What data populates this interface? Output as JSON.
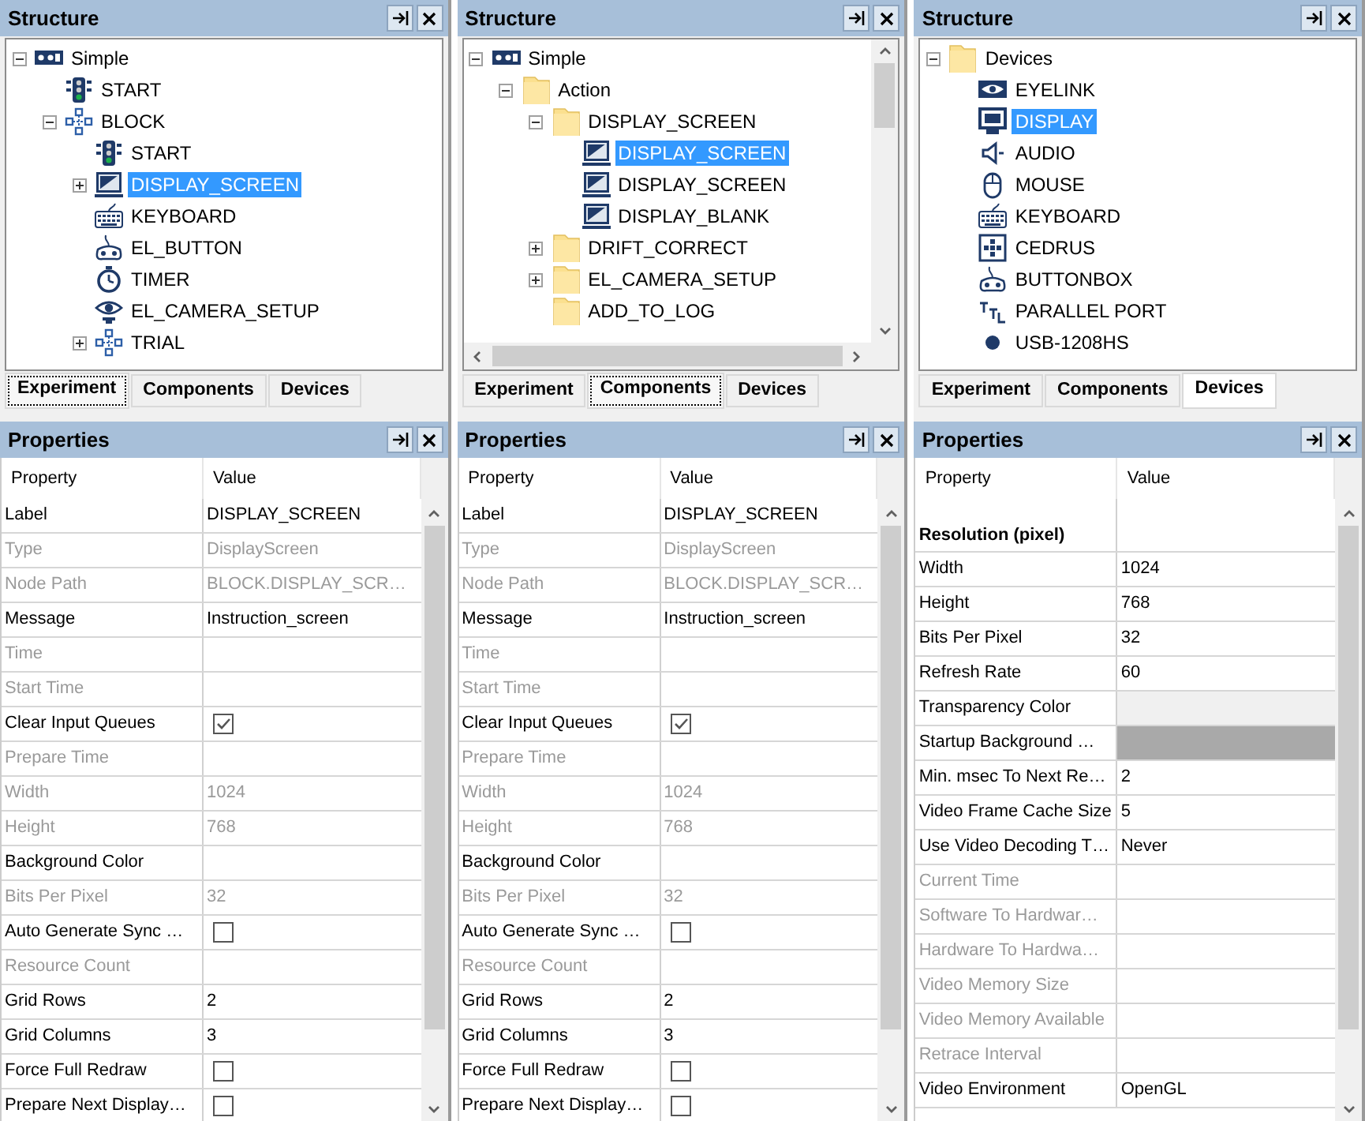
{
  "panels": [
    {
      "structure": {
        "kind": "plain",
        "title": "Structure",
        "tree": [
          {
            "label": "Simple",
            "kind": "experiment",
            "expanded": true,
            "selected": false,
            "children": [
              {
                "label": "START",
                "kind": "start",
                "selected": false
              },
              {
                "label": "BLOCK",
                "kind": "block",
                "expanded": true,
                "selected": false,
                "children": [
                  {
                    "label": "START",
                    "kind": "start",
                    "selected": false
                  },
                  {
                    "label": "DISPLAY_SCREEN",
                    "kind": "display",
                    "expanded": false,
                    "selected": true
                  },
                  {
                    "label": "KEYBOARD",
                    "kind": "keyboard",
                    "selected": false
                  },
                  {
                    "label": "EL_BUTTON",
                    "kind": "gamepad",
                    "selected": false
                  },
                  {
                    "label": "TIMER",
                    "kind": "timer",
                    "selected": false
                  },
                  {
                    "label": "EL_CAMERA_SETUP",
                    "kind": "camera",
                    "selected": false
                  },
                  {
                    "label": "TRIAL",
                    "kind": "block",
                    "expanded": false,
                    "selected": false
                  }
                ]
              }
            ]
          }
        ],
        "tabs": [
          {
            "label": "Experiment",
            "selected": true
          },
          {
            "label": "Components",
            "selected": false
          },
          {
            "label": "Devices",
            "selected": false
          }
        ]
      },
      "properties": {
        "title": "Properties",
        "columns": [
          "Property",
          "Value"
        ],
        "rows": [
          {
            "kind": "text",
            "property": "Label",
            "value": "DISPLAY_SCREEN",
            "disabled": false
          },
          {
            "kind": "text",
            "property": "Type",
            "value": "DisplayScreen",
            "disabled": true
          },
          {
            "kind": "text",
            "property": "Node Path",
            "value": "BLOCK.DISPLAY_SCR…",
            "disabled": true
          },
          {
            "kind": "text",
            "property": "Message",
            "value": "Instruction_screen",
            "disabled": false
          },
          {
            "kind": "text",
            "property": "Time",
            "disabled": true
          },
          {
            "kind": "text",
            "property": "Start Time",
            "disabled": true
          },
          {
            "kind": "checkbox",
            "property": "Clear Input Queues",
            "checked": true,
            "disabled": false
          },
          {
            "kind": "text",
            "property": "Prepare Time",
            "disabled": true
          },
          {
            "kind": "text",
            "property": "Width",
            "value": "1024",
            "disabled": true
          },
          {
            "kind": "text",
            "property": "Height",
            "value": "768",
            "disabled": true
          },
          {
            "kind": "text",
            "property": "Background Color",
            "disabled": false
          },
          {
            "kind": "text",
            "property": "Bits Per Pixel",
            "value": "32",
            "disabled": true
          },
          {
            "kind": "checkbox",
            "property": "Auto Generate Sync …",
            "checked": false,
            "disabled": false
          },
          {
            "kind": "text",
            "property": "Resource Count",
            "disabled": true
          },
          {
            "kind": "text",
            "property": "Grid Rows",
            "value": "2",
            "disabled": false
          },
          {
            "kind": "text",
            "property": "Grid Columns",
            "value": "3",
            "disabled": false
          },
          {
            "kind": "checkbox",
            "property": "Force Full Redraw",
            "checked": false,
            "disabled": false
          },
          {
            "kind": "checkbox",
            "property": "Prepare Next Display…",
            "checked": false,
            "disabled": false
          }
        ]
      }
    },
    {
      "structure": {
        "kind": "scrolled",
        "title": "Structure",
        "tree": [
          {
            "label": "Simple",
            "kind": "experiment",
            "expanded": true,
            "selected": false,
            "children": [
              {
                "label": "Action",
                "kind": "folder",
                "expanded": true,
                "selected": false,
                "children": [
                  {
                    "label": "DISPLAY_SCREEN",
                    "kind": "folder",
                    "expanded": true,
                    "selected": false,
                    "children": [
                      {
                        "label": "DISPLAY_SCREEN",
                        "kind": "display",
                        "selected": true
                      },
                      {
                        "label": "DISPLAY_SCREEN",
                        "kind": "display",
                        "selected": false
                      },
                      {
                        "label": "DISPLAY_BLANK",
                        "kind": "display",
                        "selected": false
                      }
                    ]
                  },
                  {
                    "label": "DRIFT_CORRECT",
                    "kind": "folder",
                    "expanded": false,
                    "selected": false
                  },
                  {
                    "label": "EL_CAMERA_SETUP",
                    "kind": "folder",
                    "expanded": false,
                    "selected": false
                  },
                  {
                    "label": "ADD_TO_LOG",
                    "kind": "folder",
                    "selected": false
                  }
                ]
              }
            ]
          }
        ],
        "tabs": [
          {
            "label": "Experiment",
            "selected": false
          },
          {
            "label": "Components",
            "selected": true
          },
          {
            "label": "Devices",
            "selected": false
          }
        ]
      },
      "properties": {
        "title": "Properties",
        "columns": [
          "Property",
          "Value"
        ],
        "rows": [
          {
            "kind": "text",
            "property": "Label",
            "value": "DISPLAY_SCREEN",
            "disabled": false
          },
          {
            "kind": "text",
            "property": "Type",
            "value": "DisplayScreen",
            "disabled": true
          },
          {
            "kind": "text",
            "property": "Node Path",
            "value": "BLOCK.DISPLAY_SCR…",
            "disabled": true
          },
          {
            "kind": "text",
            "property": "Message",
            "value": "Instruction_screen",
            "disabled": false
          },
          {
            "kind": "text",
            "property": "Time",
            "disabled": true
          },
          {
            "kind": "text",
            "property": "Start Time",
            "disabled": true
          },
          {
            "kind": "checkbox",
            "property": "Clear Input Queues",
            "checked": true,
            "disabled": false
          },
          {
            "kind": "text",
            "property": "Prepare Time",
            "disabled": true
          },
          {
            "kind": "text",
            "property": "Width",
            "value": "1024",
            "disabled": true
          },
          {
            "kind": "text",
            "property": "Height",
            "value": "768",
            "disabled": true
          },
          {
            "kind": "text",
            "property": "Background Color",
            "disabled": false
          },
          {
            "kind": "text",
            "property": "Bits Per Pixel",
            "value": "32",
            "disabled": true
          },
          {
            "kind": "checkbox",
            "property": "Auto Generate Sync …",
            "checked": false,
            "disabled": false
          },
          {
            "kind": "text",
            "property": "Resource Count",
            "disabled": true
          },
          {
            "kind": "text",
            "property": "Grid Rows",
            "value": "2",
            "disabled": false
          },
          {
            "kind": "text",
            "property": "Grid Columns",
            "value": "3",
            "disabled": false
          },
          {
            "kind": "checkbox",
            "property": "Force Full Redraw",
            "checked": false,
            "disabled": false
          },
          {
            "kind": "checkbox",
            "property": "Prepare Next Display…",
            "checked": false,
            "disabled": false
          }
        ]
      }
    },
    {
      "structure": {
        "kind": "plain",
        "title": "Structure",
        "tree": [
          {
            "label": "Devices",
            "kind": "folder",
            "expanded": true,
            "selected": false,
            "children": [
              {
                "label": "EYELINK",
                "kind": "eyelink",
                "selected": false
              },
              {
                "label": "DISPLAY",
                "kind": "monitor",
                "selected": true
              },
              {
                "label": "AUDIO",
                "kind": "audio",
                "selected": false
              },
              {
                "label": "MOUSE",
                "kind": "mouse",
                "selected": false
              },
              {
                "label": "KEYBOARD",
                "kind": "keyboard",
                "selected": false
              },
              {
                "label": "CEDRUS",
                "kind": "keypad",
                "selected": false
              },
              {
                "label": "BUTTONBOX",
                "kind": "gamepad",
                "selected": false
              },
              {
                "label": "PARALLEL PORT",
                "kind": "ttl",
                "selected": false
              },
              {
                "label": "USB-1208HS",
                "kind": "dot",
                "selected": false
              }
            ]
          }
        ],
        "tabs": [
          {
            "label": "Experiment",
            "selected": false
          },
          {
            "label": "Components",
            "selected": false
          },
          {
            "label": "Devices",
            "selected": true
          }
        ]
      },
      "properties": {
        "title": "Properties",
        "columns": [
          "Property",
          "Value"
        ],
        "rows": [
          {
            "kind": "group",
            "property": "Resolution (pixel)"
          },
          {
            "kind": "text",
            "property": "Width",
            "value": "1024",
            "disabled": false
          },
          {
            "kind": "text",
            "property": "Height",
            "value": "768",
            "disabled": false
          },
          {
            "kind": "text",
            "property": "Bits Per Pixel",
            "value": "32",
            "disabled": false
          },
          {
            "kind": "text",
            "property": "Refresh Rate",
            "value": "60",
            "disabled": false
          },
          {
            "kind": "color",
            "property": "Transparency Color",
            "color": "#f0f0f0",
            "disabled": false
          },
          {
            "kind": "color",
            "property": "Startup Background …",
            "color": "#a9a9a9",
            "disabled": false
          },
          {
            "kind": "text",
            "property": "Min. msec To Next Re…",
            "value": "2",
            "disabled": false
          },
          {
            "kind": "text",
            "property": "Video Frame Cache Size",
            "value": "5",
            "disabled": false
          },
          {
            "kind": "text",
            "property": "Use Video Decoding T…",
            "value": "Never",
            "disabled": false
          },
          {
            "kind": "text",
            "property": "Current Time",
            "disabled": true
          },
          {
            "kind": "text",
            "property": "Software To Hardwar…",
            "disabled": true
          },
          {
            "kind": "text",
            "property": "Hardware To Hardwa…",
            "disabled": true
          },
          {
            "kind": "text",
            "property": "Video Memory Size",
            "disabled": true
          },
          {
            "kind": "text",
            "property": "Video Memory Available",
            "disabled": true
          },
          {
            "kind": "text",
            "property": "Retrace Interval",
            "disabled": true
          },
          {
            "kind": "text",
            "property": "Video Environment",
            "value": "OpenGL",
            "disabled": false
          }
        ]
      }
    }
  ]
}
